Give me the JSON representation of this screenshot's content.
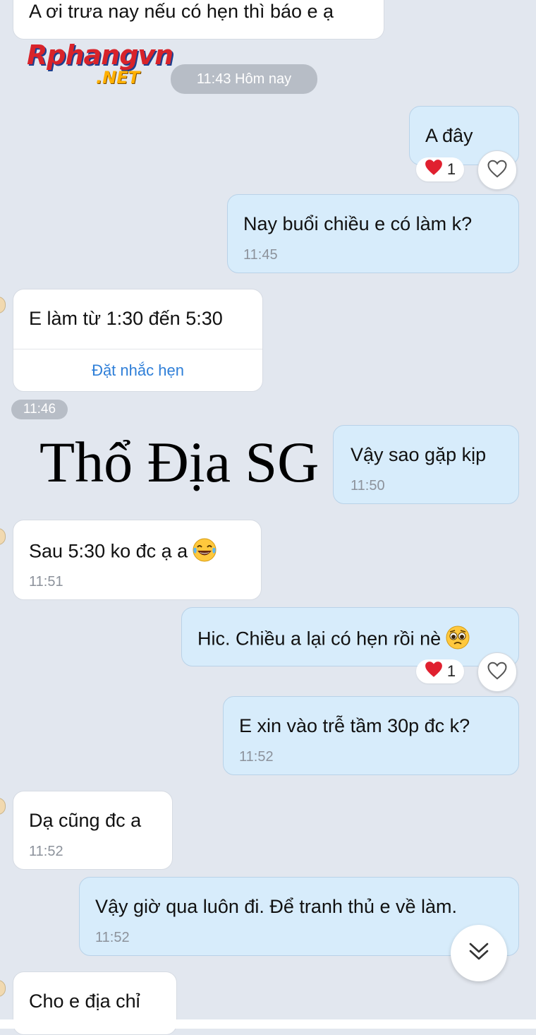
{
  "watermark": {
    "logo_top": "Rphangvn",
    "logo_bottom": ".NET",
    "big_text": "Thổ Địa SG"
  },
  "dividers": {
    "today": "11:43 Hôm nay",
    "time_1146": "11:46"
  },
  "messages": [
    {
      "dir": "in",
      "text": "A ơi trưa nay nếu có hẹn thì báo e ạ"
    },
    {
      "dir": "out",
      "text": "A đây",
      "reaction": {
        "emoji": "heart",
        "count": "1"
      }
    },
    {
      "dir": "out",
      "text": "Nay buổi chiều e có làm k?",
      "time": "11:45"
    },
    {
      "dir": "in",
      "text": "E làm từ 1:30 đến 5:30",
      "action": "Đặt nhắc hẹn"
    },
    {
      "dir": "out",
      "text": "Vậy sao gặp kịp",
      "time": "11:50"
    },
    {
      "dir": "in",
      "text": "Sau 5:30 ko đc ạ a",
      "emoji": "laughing-tears",
      "time": "11:51"
    },
    {
      "dir": "out",
      "text": "Hic. Chiều a lại có hẹn rồi nè",
      "emoji": "pleading-face",
      "reaction": {
        "emoji": "heart",
        "count": "1"
      }
    },
    {
      "dir": "out",
      "text": "E xin vào trễ tầm 30p đc k?",
      "time": "11:52"
    },
    {
      "dir": "in",
      "text": "Dạ cũng đc a",
      "time": "11:52"
    },
    {
      "dir": "out",
      "text": "Vậy giờ qua luôn đi. Để tranh thủ e về làm.",
      "time": "11:52"
    },
    {
      "dir": "in",
      "text": "Cho e địa chỉ"
    }
  ],
  "colors": {
    "incoming": "#ffffff",
    "outgoing": "#d7ecfb",
    "background": "#e2e7ef",
    "link": "#2f7fd8",
    "heart": "#e0202f"
  }
}
